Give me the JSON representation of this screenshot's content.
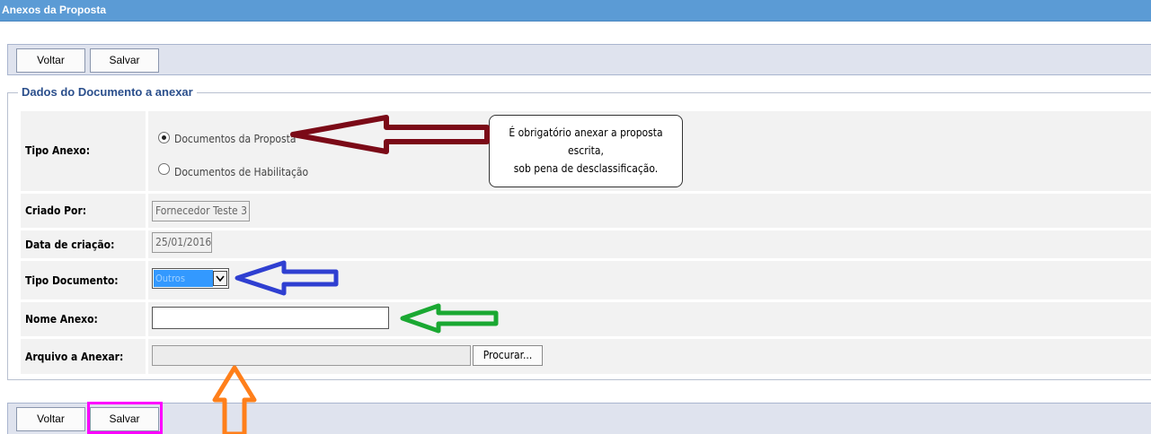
{
  "window": {
    "title": "Anexos da Proposta"
  },
  "toolbar_top": {
    "voltar": "Voltar",
    "salvar": "Salvar"
  },
  "toolbar_bottom": {
    "voltar": "Voltar",
    "salvar": "Salvar"
  },
  "fieldset": {
    "legend": "Dados do Documento a anexar"
  },
  "form": {
    "tipo_anexo": {
      "label": "Tipo Anexo:",
      "options": [
        "Documentos da Proposta",
        "Documentos de Habilitação"
      ],
      "selected": "Documentos da Proposta"
    },
    "criado_por": {
      "label": "Criado Por:",
      "value": "Fornecedor Teste 3"
    },
    "data_criacao": {
      "label": "Data de criação:",
      "value": "25/01/2016"
    },
    "tipo_documento": {
      "label": "Tipo Documento:",
      "value": "Outros"
    },
    "nome_anexo": {
      "label": "Nome Anexo:",
      "value": ""
    },
    "arquivo": {
      "label": "Arquivo a Anexar:",
      "value": "",
      "button": "Procurar..."
    }
  },
  "tooltip": {
    "line1": "É obrigatório anexar a proposta escrita,",
    "line2": "sob pena de desclassificação."
  },
  "annotation_colors": {
    "dark_red_arrow": "#7b0a17",
    "blue_arrow": "#2f3fd1",
    "green_arrow": "#1aa832",
    "orange_arrow": "#ff7f1a",
    "magenta_box": "#ff00ff"
  }
}
